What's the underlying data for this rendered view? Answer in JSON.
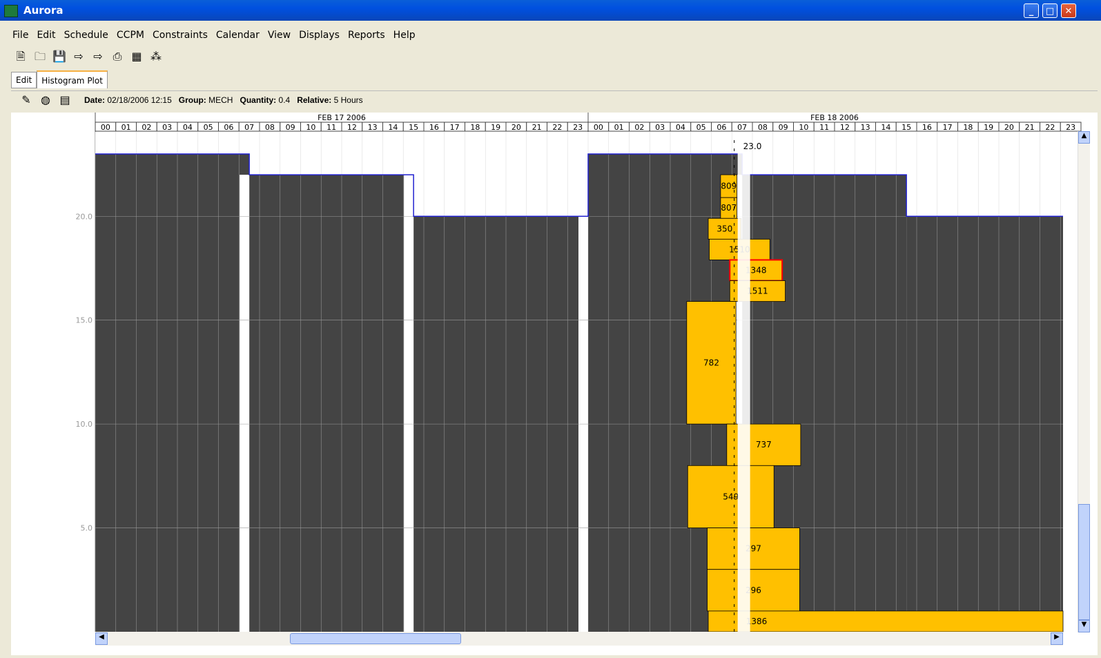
{
  "window": {
    "title": "Aurora"
  },
  "menu": [
    "File",
    "Edit",
    "Schedule",
    "CCPM",
    "Constraints",
    "Calendar",
    "View",
    "Displays",
    "Reports",
    "Help"
  ],
  "toolbar_icons": [
    "new-document-icon",
    "open-folder-icon",
    "save-icon",
    "forward-icon",
    "forward-icon",
    "print-icon",
    "calendar-icon",
    "network-icon"
  ],
  "tabs": [
    {
      "label": "Edit",
      "active": false
    },
    {
      "label": "Histogram Plot",
      "active": true
    }
  ],
  "info": {
    "icons": [
      "edit-note-icon",
      "palette-icon",
      "report-icon"
    ],
    "date_label": "Date:",
    "date_value": "02/18/2006 12:15",
    "group_label": "Group:",
    "group_value": "MECH",
    "quantity_label": "Quantity:",
    "quantity_value": "0.4",
    "relative_label": "Relative:",
    "relative_value": "5 Hours"
  },
  "colors": {
    "background_capacity": "#444444",
    "bar_fill": "#FFC000",
    "bar_highlight": "#FF0000",
    "capacity_line": "#2020D0"
  },
  "chart_data": {
    "type": "histogram",
    "dates": [
      "FEB 17 2006",
      "FEB 18 2006"
    ],
    "hours": [
      "00",
      "01",
      "02",
      "03",
      "04",
      "05",
      "06",
      "07",
      "08",
      "09",
      "10",
      "11",
      "12",
      "13",
      "14",
      "15",
      "16",
      "17",
      "18",
      "19",
      "20",
      "21",
      "22",
      "23"
    ],
    "y_ticks": [
      "20.0",
      "15.0",
      "10.0",
      "5.0"
    ],
    "ylim": [
      0,
      23.0
    ],
    "capacity_label": "23.0",
    "capacity": [
      {
        "day": 0,
        "from": 0,
        "to": 7.5,
        "value": 23
      },
      {
        "day": 0,
        "from": 7.5,
        "to": 15.5,
        "value": 22
      },
      {
        "day": 0,
        "from": 15.5,
        "to": 24,
        "value": 20
      },
      {
        "day": 1,
        "from": 0,
        "to": 7.5,
        "value": 23
      },
      {
        "day": 1,
        "from": 7.5,
        "to": 15.5,
        "value": 22
      },
      {
        "day": 1,
        "from": 15.5,
        "to": 24,
        "value": 20
      }
    ],
    "tasks": [
      {
        "label": "809",
        "start": 6.45,
        "end": 7.25,
        "low": 20.9,
        "high": 22.0,
        "highlight": false
      },
      {
        "label": "807",
        "start": 6.45,
        "end": 7.25,
        "low": 19.9,
        "high": 20.9,
        "highlight": false
      },
      {
        "label": "350",
        "start": 5.85,
        "end": 7.45,
        "low": 18.9,
        "high": 19.9,
        "highlight": false
      },
      {
        "label": "1510",
        "start": 5.9,
        "end": 8.85,
        "low": 17.9,
        "high": 18.9,
        "highlight": false
      },
      {
        "label": "1348",
        "start": 6.9,
        "end": 9.45,
        "low": 16.9,
        "high": 17.9,
        "highlight": true
      },
      {
        "label": "1511",
        "start": 6.9,
        "end": 9.6,
        "low": 15.9,
        "high": 16.9,
        "highlight": false
      },
      {
        "label": "782",
        "start": 4.8,
        "end": 7.2,
        "low": 10.0,
        "high": 15.9,
        "highlight": false
      },
      {
        "label": "737",
        "start": 6.75,
        "end": 10.35,
        "low": 8.0,
        "high": 10.0,
        "highlight": false
      },
      {
        "label": "549",
        "start": 4.85,
        "end": 9.05,
        "low": 5.0,
        "high": 8.0,
        "highlight": false
      },
      {
        "label": "297",
        "start": 5.8,
        "end": 10.3,
        "low": 3.0,
        "high": 5.0,
        "highlight": false
      },
      {
        "label": "296",
        "start": 5.8,
        "end": 10.3,
        "low": 1.0,
        "high": 3.0,
        "highlight": false
      },
      {
        "label": "1386",
        "start": 5.85,
        "end": 24,
        "low": 0,
        "high": 1.0,
        "highlight": false
      }
    ]
  }
}
